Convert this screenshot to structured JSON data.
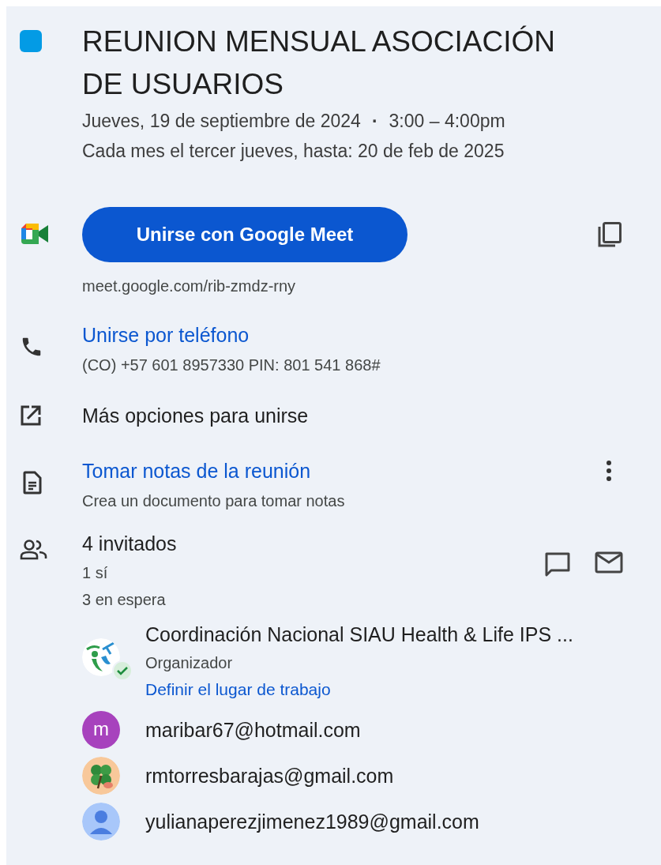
{
  "event": {
    "title": "REUNION MENSUAL ASOCIACIÓN DE USUARIOS",
    "date": "Jueves, 19 de septiembre de 2024",
    "separator": "·",
    "time": "3:00 – 4:00pm",
    "recurrence": "Cada mes el tercer jueves, hasta: 20 de feb de 2025"
  },
  "meet": {
    "button": "Unirse con Google Meet",
    "url": "meet.google.com/rib-zmdz-rny"
  },
  "phone": {
    "link": "Unirse por teléfono",
    "number": "(CO) +57 601 8957330 PIN: 801 541 868#"
  },
  "more_options": "Más opciones para unirse",
  "notes": {
    "link": "Tomar notas de la reunión",
    "hint": "Crea un documento para tomar notas"
  },
  "guests": {
    "count": "4 invitados",
    "yes": "1 sí",
    "waiting": "3 en espera",
    "list": [
      {
        "kind": "logo",
        "name": "Coordinación Nacional SIAU Health & Life IPS ...",
        "accepted": true,
        "role": "Organizador",
        "action": "Definir el lugar de trabajo"
      },
      {
        "kind": "letter",
        "letter": "m",
        "color": "#a742bd",
        "name": "maribar67@hotmail.com",
        "accepted": false
      },
      {
        "kind": "clover",
        "name": "rmtorresbarajas@gmail.com",
        "accepted": false
      },
      {
        "kind": "person",
        "name": "yulianaperezjimenez1989@gmail.com",
        "accepted": false
      }
    ]
  }
}
